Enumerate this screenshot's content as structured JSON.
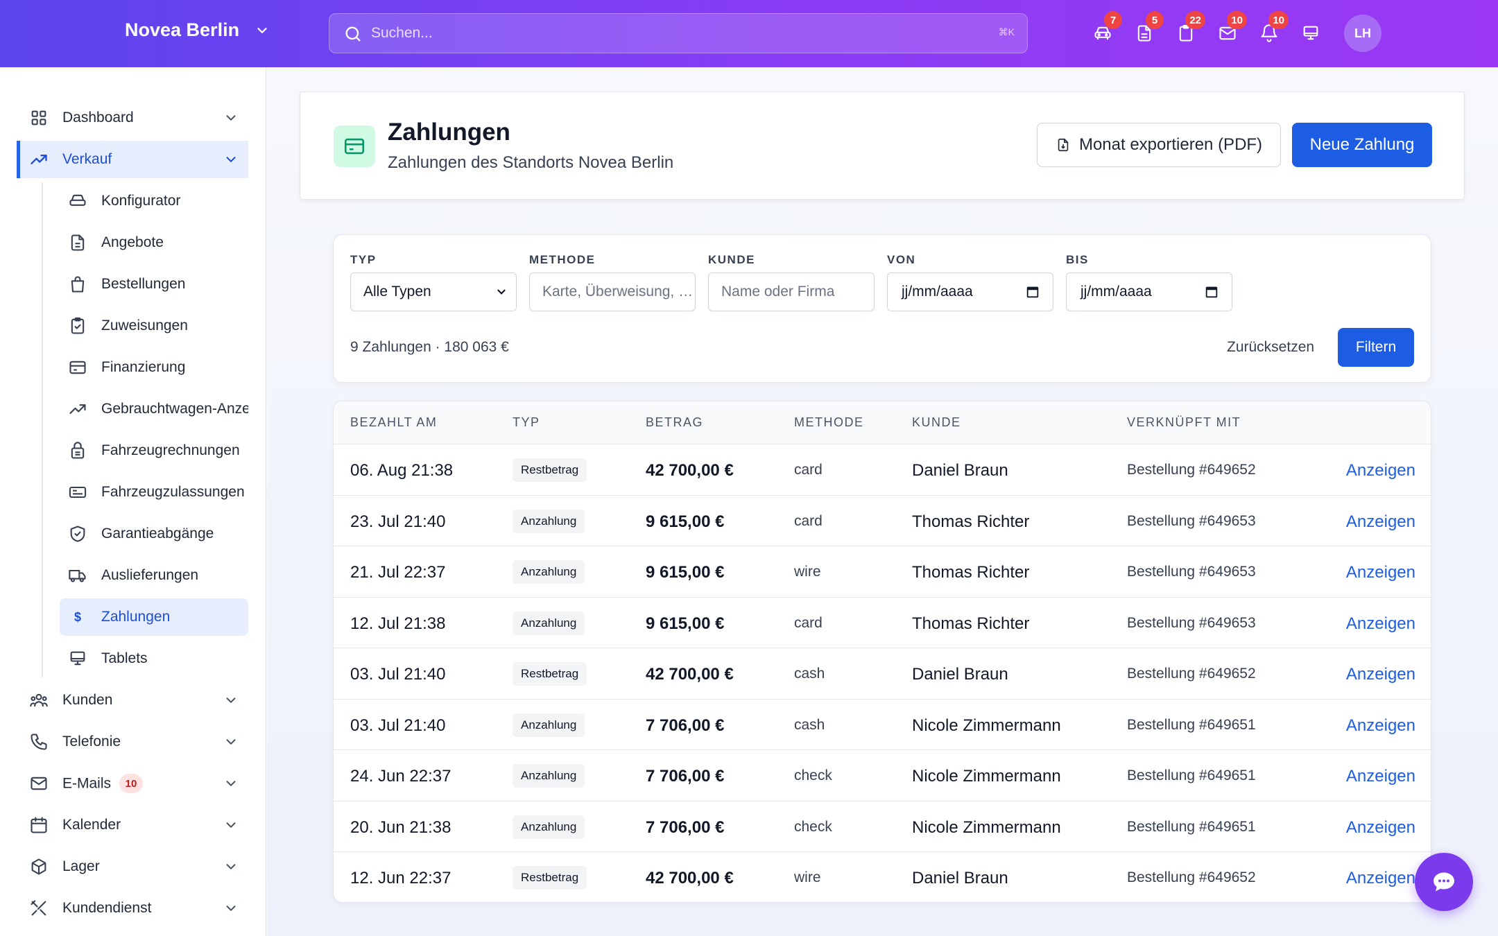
{
  "topbar": {
    "brand": "Novea Berlin",
    "search_placeholder": "Suchen...",
    "search_shortcut": "⌘K",
    "icons": [
      {
        "name": "car-icon",
        "badge": "7"
      },
      {
        "name": "document-icon",
        "badge": "5"
      },
      {
        "name": "clipboard-icon",
        "badge": "22"
      },
      {
        "name": "mail-icon",
        "badge": "10"
      },
      {
        "name": "bell-icon",
        "badge": "10"
      },
      {
        "name": "monitor-icon",
        "badge": ""
      }
    ],
    "avatar_initials": "LH"
  },
  "sidebar": {
    "dashboard": "Dashboard",
    "verkauf": "Verkauf",
    "sub_items": [
      "Konfigurator",
      "Angebote",
      "Bestellungen",
      "Zuweisungen",
      "Finanzierung",
      "Gebrauchtwagen-Anzeigen",
      "Fahrzeugrechnungen",
      "Fahrzeugzulassungen",
      "Garantieabgänge",
      "Auslieferungen",
      "Zahlungen",
      "Tablets"
    ],
    "active_sub": "Zahlungen",
    "kunden": "Kunden",
    "telefonie": "Telefonie",
    "emails": "E-Mails",
    "emails_badge": "10",
    "kalender": "Kalender",
    "lager": "Lager",
    "kundendienst": "Kundendienst"
  },
  "header": {
    "title": "Zahlungen",
    "subtitle": "Zahlungen des Standorts Novea Berlin",
    "export_label": "Monat exportieren (PDF)",
    "new_label": "Neue Zahlung"
  },
  "filters": {
    "typ_label": "TYP",
    "typ_value": "Alle Typen",
    "methode_label": "METHODE",
    "methode_placeholder": "Karte, Überweisung, …",
    "kunde_label": "KUNDE",
    "kunde_placeholder": "Name oder Firma",
    "von_label": "VON",
    "von_value": "jj/mm/aaaa",
    "bis_label": "BIS",
    "bis_value": "jj/mm/aaaa",
    "summary": "9 Zahlungen · 180 063 €",
    "reset_label": "Zurücksetzen",
    "filter_label": "Filtern"
  },
  "table": {
    "columns": [
      "BEZAHLT AM",
      "TYP",
      "BETRAG",
      "METHODE",
      "KUNDE",
      "VERKNÜPFT MIT"
    ],
    "action_label": "Anzeigen",
    "rows": [
      {
        "date": "06. Aug 21:38",
        "type": "Restbetrag",
        "amount": "42 700,00 €",
        "method": "card",
        "customer": "Daniel Braun",
        "linked": "Bestellung #649652"
      },
      {
        "date": "23. Jul 21:40",
        "type": "Anzahlung",
        "amount": "9 615,00 €",
        "method": "card",
        "customer": "Thomas Richter",
        "linked": "Bestellung #649653"
      },
      {
        "date": "21. Jul 22:37",
        "type": "Anzahlung",
        "amount": "9 615,00 €",
        "method": "wire",
        "customer": "Thomas Richter",
        "linked": "Bestellung #649653"
      },
      {
        "date": "12. Jul 21:38",
        "type": "Anzahlung",
        "amount": "9 615,00 €",
        "method": "card",
        "customer": "Thomas Richter",
        "linked": "Bestellung #649653"
      },
      {
        "date": "03. Jul 21:40",
        "type": "Restbetrag",
        "amount": "42 700,00 €",
        "method": "cash",
        "customer": "Daniel Braun",
        "linked": "Bestellung #649652"
      },
      {
        "date": "03. Jul 21:40",
        "type": "Anzahlung",
        "amount": "7 706,00 €",
        "method": "cash",
        "customer": "Nicole Zimmermann",
        "linked": "Bestellung #649651"
      },
      {
        "date": "24. Jun 22:37",
        "type": "Anzahlung",
        "amount": "7 706,00 €",
        "method": "check",
        "customer": "Nicole Zimmermann",
        "linked": "Bestellung #649651"
      },
      {
        "date": "20. Jun 21:38",
        "type": "Anzahlung",
        "amount": "7 706,00 €",
        "method": "check",
        "customer": "Nicole Zimmermann",
        "linked": "Bestellung #649651"
      },
      {
        "date": "12. Jun 22:37",
        "type": "Restbetrag",
        "amount": "42 700,00 €",
        "method": "wire",
        "customer": "Daniel Braun",
        "linked": "Bestellung #649652"
      }
    ]
  },
  "colors": {
    "accent": "#1d5de4",
    "topbar_start": "#5b45ee",
    "topbar_end": "#9a38f3",
    "badge": "#ef4444"
  }
}
